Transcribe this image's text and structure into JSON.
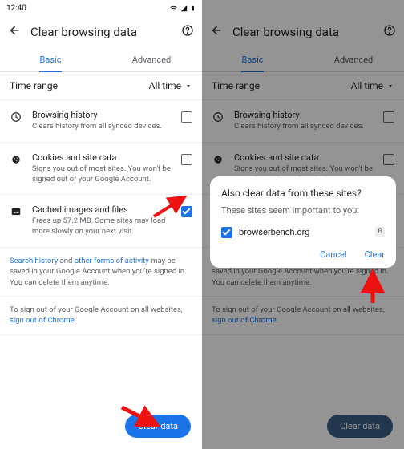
{
  "statusbar": {
    "time": "12:40"
  },
  "header": {
    "title": "Clear browsing data"
  },
  "tabs": {
    "basic": "Basic",
    "advanced": "Advanced"
  },
  "timerange": {
    "label": "Time range",
    "value": "All time"
  },
  "options": {
    "history": {
      "title": "Browsing history",
      "sub": "Clears history from all synced devices."
    },
    "cookies": {
      "title": "Cookies and site data",
      "sub": "Signs you out of most sites. You won't be signed out of your Google Account."
    },
    "cache": {
      "title": "Cached images and files",
      "sub": "Frees up 57.2 MB. Some sites may load more slowly on your next visit."
    }
  },
  "info1": {
    "a": "Search history",
    "b": " and ",
    "c": "other forms of activity",
    "d": " may be saved in your Google Account when you're signed in. You can delete them anytime."
  },
  "info2": {
    "a": "To sign out of your Google Account on all websites, ",
    "b": "sign out of Chrome",
    "c": "."
  },
  "cta": "Clear data",
  "dialog": {
    "title": "Also clear data from these sites?",
    "sub": "These sites seem important to you:",
    "site": "browserbench.org",
    "badge": "B",
    "cancel": "Cancel",
    "clear": "Clear"
  }
}
